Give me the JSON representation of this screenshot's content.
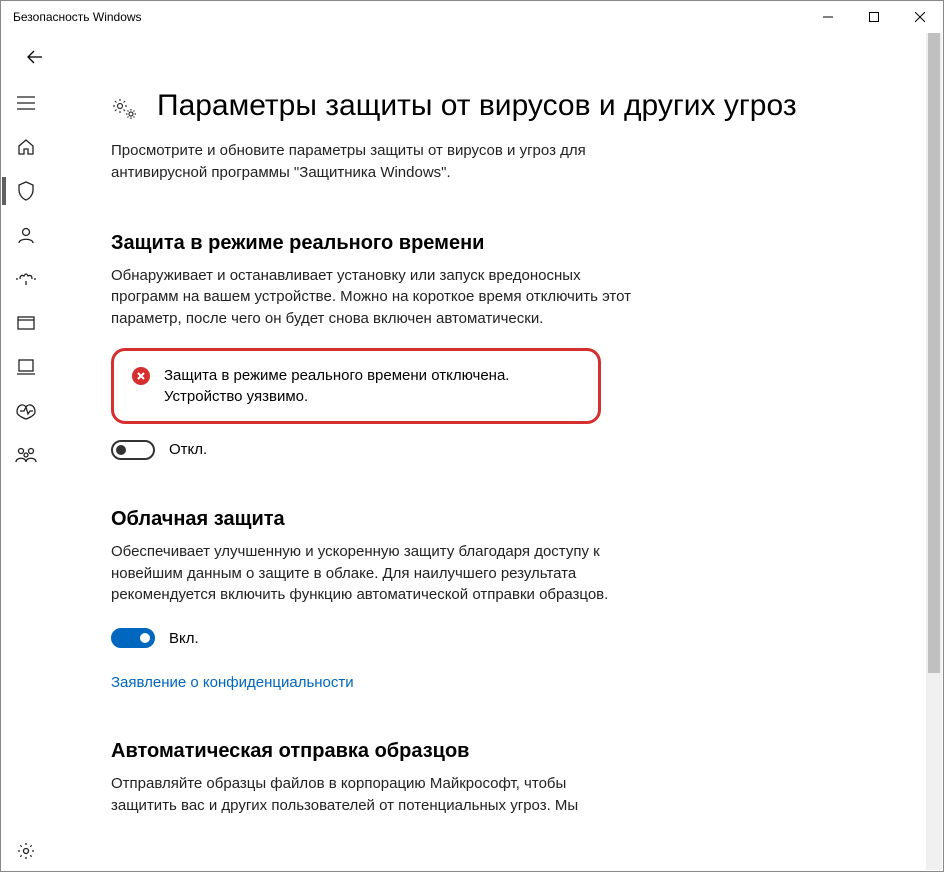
{
  "window": {
    "title": "Безопасность Windows"
  },
  "page": {
    "title": "Параметры защиты от вирусов и других угроз",
    "description": "Просмотрите и обновите параметры защиты от вирусов и угроз для антивирусной программы \"Защитника Windows\"."
  },
  "sections": {
    "realtime": {
      "title": "Защита в режиме реального времени",
      "desc": "Обнаруживает и останавливает установку или запуск вредоносных программ на вашем устройстве. Можно на короткое время отключить этот параметр, после чего он будет снова включен автоматически.",
      "alert": "Защита в режиме реального времени отключена. Устройство уязвимо.",
      "toggle_label": "Откл."
    },
    "cloud": {
      "title": "Облачная защита",
      "desc": "Обеспечивает улучшенную и ускоренную защиту благодаря доступу к новейшим данным о защите в облаке. Для наилучшего результата рекомендуется включить функцию автоматической отправки образцов.",
      "toggle_label": "Вкл.",
      "privacy_link": "Заявление о конфиденциальности"
    },
    "samples": {
      "title": "Автоматическая отправка образцов",
      "desc": "Отправляйте образцы файлов в корпорацию Майкрософт, чтобы защитить вас и других пользователей от потенциальных угроз. Мы"
    }
  }
}
